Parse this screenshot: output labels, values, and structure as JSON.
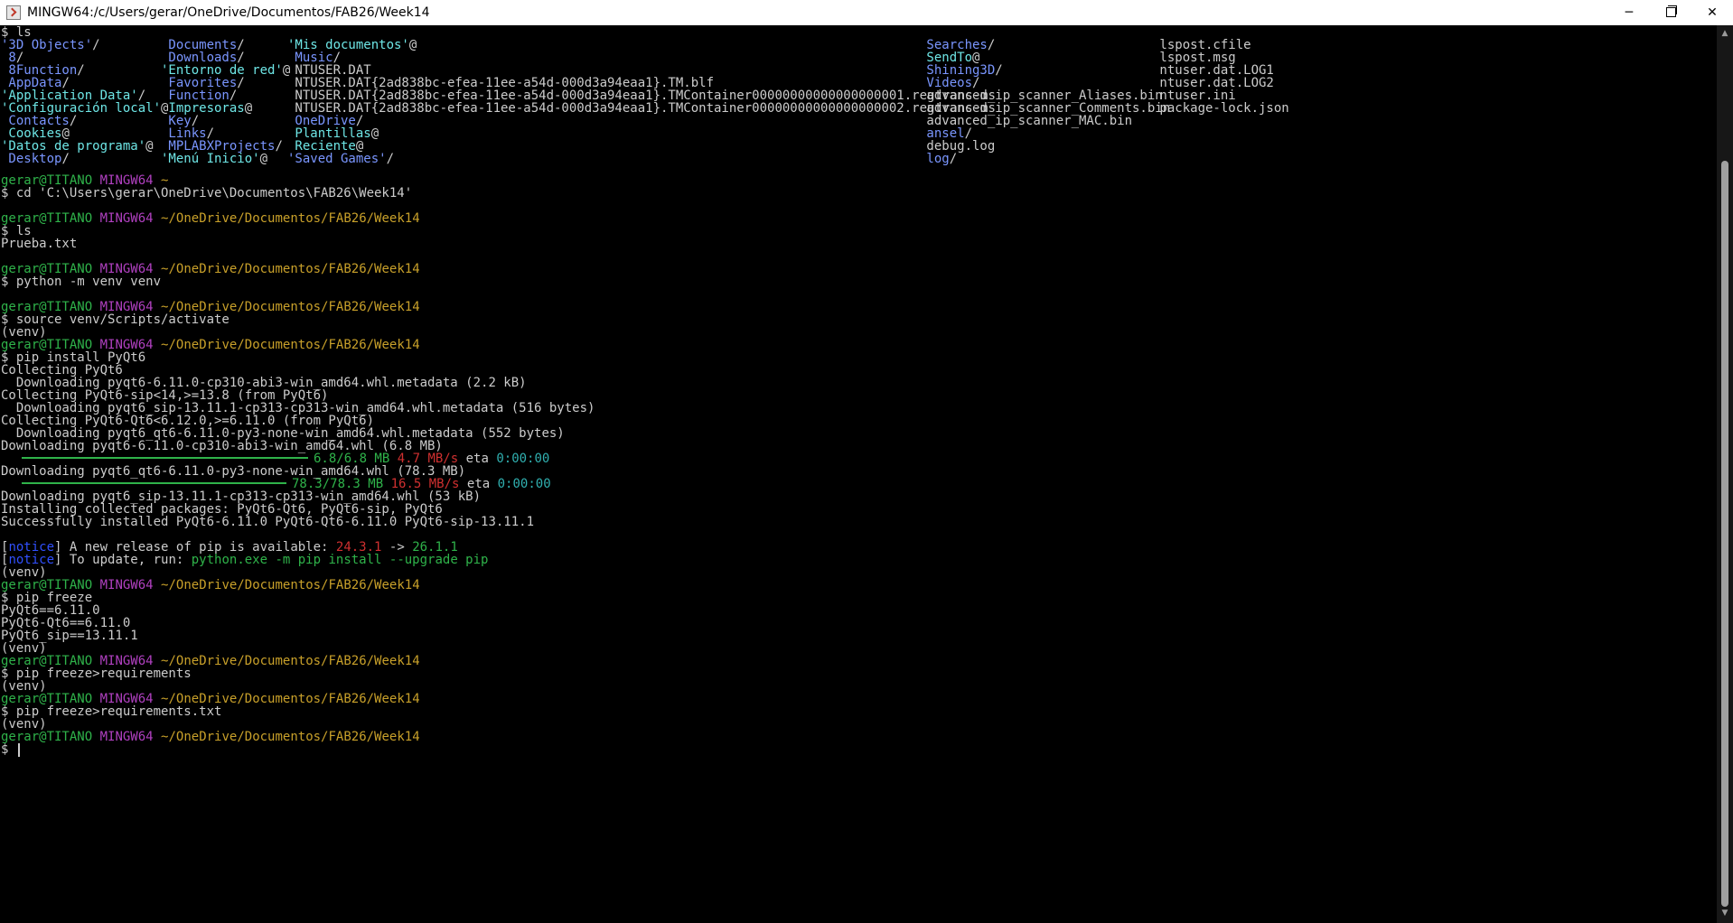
{
  "window": {
    "title": "MINGW64:/c/Users/gerar/OneDrive/Documentos/FAB26/Week14",
    "minimize_glyph": "─",
    "close_glyph": "✕"
  },
  "colors": {
    "background": "#000000",
    "text": "#cccccc",
    "directory": "#7a96ff",
    "symlink": "#6ee6e6",
    "user_host": "#2fb34a",
    "msystem": "#b040c0",
    "cwd": "#c8a02a"
  },
  "prompt": {
    "user_host": "gerar@TITANO",
    "msystem": "MINGW64",
    "home_path": "~",
    "week_path": "~/OneDrive/Documentos/FAB26/Week14",
    "symbol": "$"
  },
  "ls_command": "$ ls",
  "ls_columns": [
    [
      {
        "name": "'3D Objects'",
        "suffix": "/",
        "kind": "dir"
      },
      {
        "name": " 8",
        "suffix": "/",
        "kind": "dir"
      },
      {
        "name": " 8Function",
        "suffix": "/",
        "kind": "dir"
      },
      {
        "name": " AppData",
        "suffix": "/",
        "kind": "dir"
      },
      {
        "name": "'Application Data'",
        "suffix": "/",
        "kind": "link"
      },
      {
        "name": "'Configuración local'",
        "suffix": "@",
        "kind": "link"
      },
      {
        "name": " Contacts",
        "suffix": "/",
        "kind": "dir"
      },
      {
        "name": " Cookies",
        "suffix": "@",
        "kind": "link"
      },
      {
        "name": "'Datos de programa'",
        "suffix": "@",
        "kind": "link"
      },
      {
        "name": " Desktop",
        "suffix": "/",
        "kind": "dir"
      }
    ],
    [
      {
        "name": " Documents",
        "suffix": "/",
        "kind": "dir"
      },
      {
        "name": " Downloads",
        "suffix": "/",
        "kind": "dir"
      },
      {
        "name": "'Entorno de red'",
        "suffix": "@",
        "kind": "link"
      },
      {
        "name": " Favorites",
        "suffix": "/",
        "kind": "dir"
      },
      {
        "name": " Function",
        "suffix": "/",
        "kind": "dir"
      },
      {
        "name": " Impresoras",
        "suffix": "@",
        "kind": "link"
      },
      {
        "name": " Key",
        "suffix": "/",
        "kind": "dir"
      },
      {
        "name": " Links",
        "suffix": "/",
        "kind": "dir"
      },
      {
        "name": " MPLABXProjects",
        "suffix": "/",
        "kind": "dir"
      },
      {
        "name": "'Menú Inicio'",
        "suffix": "@",
        "kind": "link"
      }
    ],
    [
      {
        "name": "'Mis documentos'",
        "suffix": "@",
        "kind": "link"
      },
      {
        "name": " Music",
        "suffix": "/",
        "kind": "dir"
      },
      {
        "name": " NTUSER.DAT",
        "suffix": "",
        "kind": "file"
      },
      {
        "name": " NTUSER.DAT{2ad838bc-efea-11ee-a54d-000d3a94eaa1}.TM.blf",
        "suffix": "",
        "kind": "file"
      },
      {
        "name": " NTUSER.DAT{2ad838bc-efea-11ee-a54d-000d3a94eaa1}.TMContainer00000000000000000001.regtrans-ms",
        "suffix": "",
        "kind": "file"
      },
      {
        "name": " NTUSER.DAT{2ad838bc-efea-11ee-a54d-000d3a94eaa1}.TMContainer00000000000000000002.regtrans-ms",
        "suffix": "",
        "kind": "file"
      },
      {
        "name": " OneDrive",
        "suffix": "/",
        "kind": "dir"
      },
      {
        "name": " Plantillas",
        "suffix": "@",
        "kind": "link"
      },
      {
        "name": " Reciente",
        "suffix": "@",
        "kind": "link"
      },
      {
        "name": "'Saved Games'",
        "suffix": "/",
        "kind": "dir"
      }
    ],
    [
      {
        "name": " Searches",
        "suffix": "/",
        "kind": "dir"
      },
      {
        "name": " SendTo",
        "suffix": "@",
        "kind": "link"
      },
      {
        "name": " Shining3D",
        "suffix": "/",
        "kind": "dir"
      },
      {
        "name": " Videos",
        "suffix": "/",
        "kind": "dir"
      },
      {
        "name": " advanced_ip_scanner_Aliases.bin",
        "suffix": "",
        "kind": "file"
      },
      {
        "name": " advanced_ip_scanner_Comments.bin",
        "suffix": "",
        "kind": "file"
      },
      {
        "name": " advanced_ip_scanner_MAC.bin",
        "suffix": "",
        "kind": "file"
      },
      {
        "name": " ansel",
        "suffix": "/",
        "kind": "dir"
      },
      {
        "name": " debug.log",
        "suffix": "",
        "kind": "file"
      },
      {
        "name": " log",
        "suffix": "/",
        "kind": "dir"
      }
    ],
    [
      {
        "name": " lspost.cfile",
        "suffix": "",
        "kind": "file"
      },
      {
        "name": " lspost.msg",
        "suffix": "",
        "kind": "file"
      },
      {
        "name": " ntuser.dat.LOG1",
        "suffix": "",
        "kind": "file"
      },
      {
        "name": " ntuser.dat.LOG2",
        "suffix": "",
        "kind": "file"
      },
      {
        "name": " ntuser.ini",
        "suffix": "",
        "kind": "file"
      },
      {
        "name": " package-lock.json",
        "suffix": "",
        "kind": "file"
      }
    ]
  ],
  "session": {
    "cmd_cd": "$ cd 'C:\\Users\\gerar\\OneDrive\\Documentos\\FAB26\\Week14'",
    "cmd_ls": "$ ls",
    "out_ls": "Prueba.txt",
    "cmd_venv": "$ python -m venv venv",
    "cmd_activate": "$ source venv/Scripts/activate",
    "venv_tag": "(venv)",
    "cmd_install": "$ pip install PyQt6",
    "collecting_pyqt6": "Collecting PyQt6",
    "dl_pyqt6_meta": "  Downloading pyqt6-6.11.0-cp310-abi3-win_amd64.whl.metadata (2.2 kB)",
    "collecting_sip": "Collecting PyQt6-sip<14,>=13.8 (from PyQt6)",
    "dl_sip_meta": "  Downloading pyqt6_sip-13.11.1-cp313-cp313-win_amd64.whl.metadata (516 bytes)",
    "collecting_qt6": "Collecting PyQt6-Qt6<6.12.0,>=6.11.0 (from PyQt6)",
    "dl_qt6_meta": "  Downloading pyqt6_qt6-6.11.0-py3-none-win_amd64.whl.metadata (552 bytes)",
    "dl_pyqt6": "Downloading pyqt6-6.11.0-cp310-abi3-win_amd64.whl (6.8 MB)",
    "progress1_size": "6.8/6.8 MB",
    "progress1_speed": "4.7 MB/s",
    "progress1_eta_label": "eta",
    "progress1_eta": "0:00:00",
    "dl_qt6": "Downloading pyqt6_qt6-6.11.0-py3-none-win_amd64.whl (78.3 MB)",
    "progress2_size": "78.3/78.3 MB",
    "progress2_speed": "16.5 MB/s",
    "progress2_eta_label": "eta",
    "progress2_eta": "0:00:00",
    "dl_sip": "Downloading pyqt6_sip-13.11.1-cp313-cp313-win_amd64.whl (53 kB)",
    "installing": "Installing collected packages: PyQt6-Qt6, PyQt6-sip, PyQt6",
    "success": "Successfully installed PyQt6-6.11.0 PyQt6-Qt6-6.11.0 PyQt6-sip-13.11.1",
    "notice_tag": "notice",
    "notice1_text": " A new release of pip is available: ",
    "notice1_old": "24.3.1",
    "notice1_arrow": " -> ",
    "notice1_new": "26.1.1",
    "notice2_text": " To update, run: ",
    "notice2_cmd": "python.exe -m pip install --upgrade pip",
    "cmd_freeze": "$ pip freeze",
    "freeze_out": [
      "PyQt6==6.11.0",
      "PyQt6-Qt6==6.11.0",
      "PyQt6_sip==13.11.1"
    ],
    "cmd_freeze_req": "$ pip freeze>requirements",
    "cmd_freeze_req_txt": "$ pip freeze>requirements.txt",
    "final_prompt": "$ "
  },
  "progress": {
    "pyqt6_fraction": 1.0,
    "qt6_fraction": 1.0
  }
}
